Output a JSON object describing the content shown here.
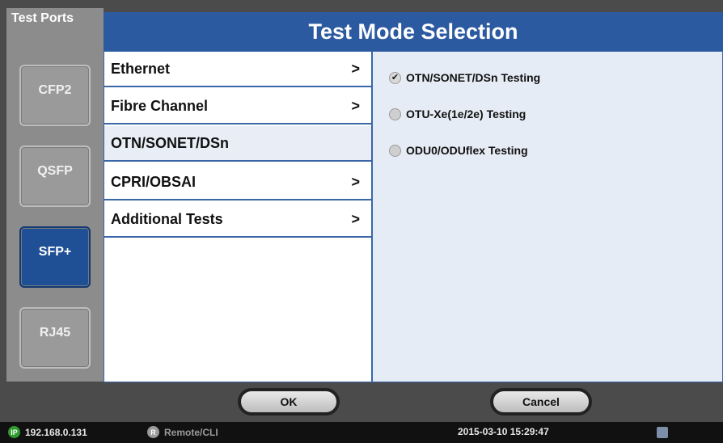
{
  "ports": {
    "title": "Test Ports",
    "buttons": [
      {
        "label": "CFP2",
        "active": false
      },
      {
        "label": "QSFP",
        "active": false
      },
      {
        "label": "SFP+",
        "active": true
      },
      {
        "label": "RJ45",
        "active": false
      }
    ]
  },
  "header": {
    "title": "Test Mode Selection"
  },
  "menu": {
    "items": [
      {
        "label": "Ethernet",
        "arrow": ">"
      },
      {
        "label": "Fibre Channel",
        "arrow": ">"
      },
      {
        "label": "OTN/SONET/DSn",
        "arrow": ""
      },
      {
        "label": "CPRI/OBSAI",
        "arrow": ">"
      },
      {
        "label": "Additional Tests",
        "arrow": ">"
      }
    ],
    "selected_index": 2
  },
  "options": {
    "items": [
      {
        "label": "OTN/SONET/DSn Testing",
        "checked": true
      },
      {
        "label": "OTU-Xe(1e/2e) Testing",
        "checked": false
      },
      {
        "label": "ODU0/ODUflex Testing",
        "checked": false
      }
    ]
  },
  "actions": {
    "ok_label": "OK",
    "cancel_label": "Cancel"
  },
  "status": {
    "ip_badge": "IP",
    "ip": "192.168.0.131",
    "remote_badge": "R",
    "remote": "Remote/CLI",
    "datetime": "2015-03-10 15:29:47"
  }
}
